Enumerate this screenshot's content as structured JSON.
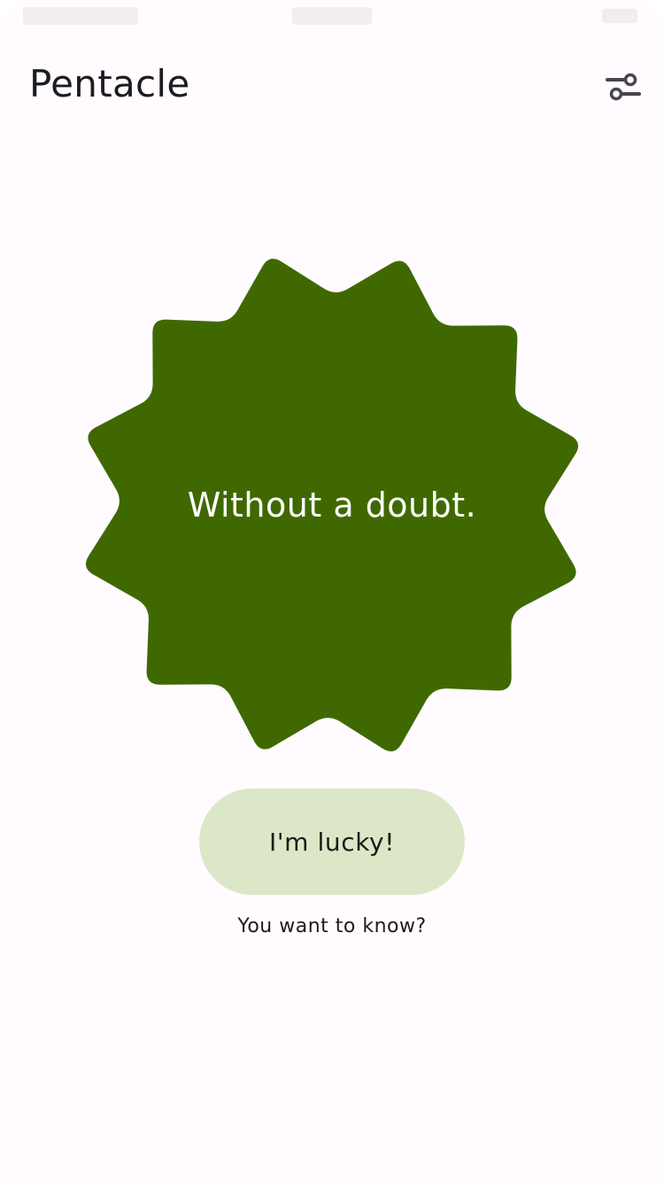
{
  "app": {
    "title": "Pentacle",
    "settings_icon": "tune-sliders-icon"
  },
  "answer": {
    "text": "Without a doubt.",
    "shape_color": "#3f6900"
  },
  "actions": {
    "lucky_label": "I'm lucky!",
    "hint": "You want to know?"
  },
  "colors": {
    "background": "#fffbfe",
    "button_bg": "#dce7c8",
    "text": "#1c1b1f"
  }
}
